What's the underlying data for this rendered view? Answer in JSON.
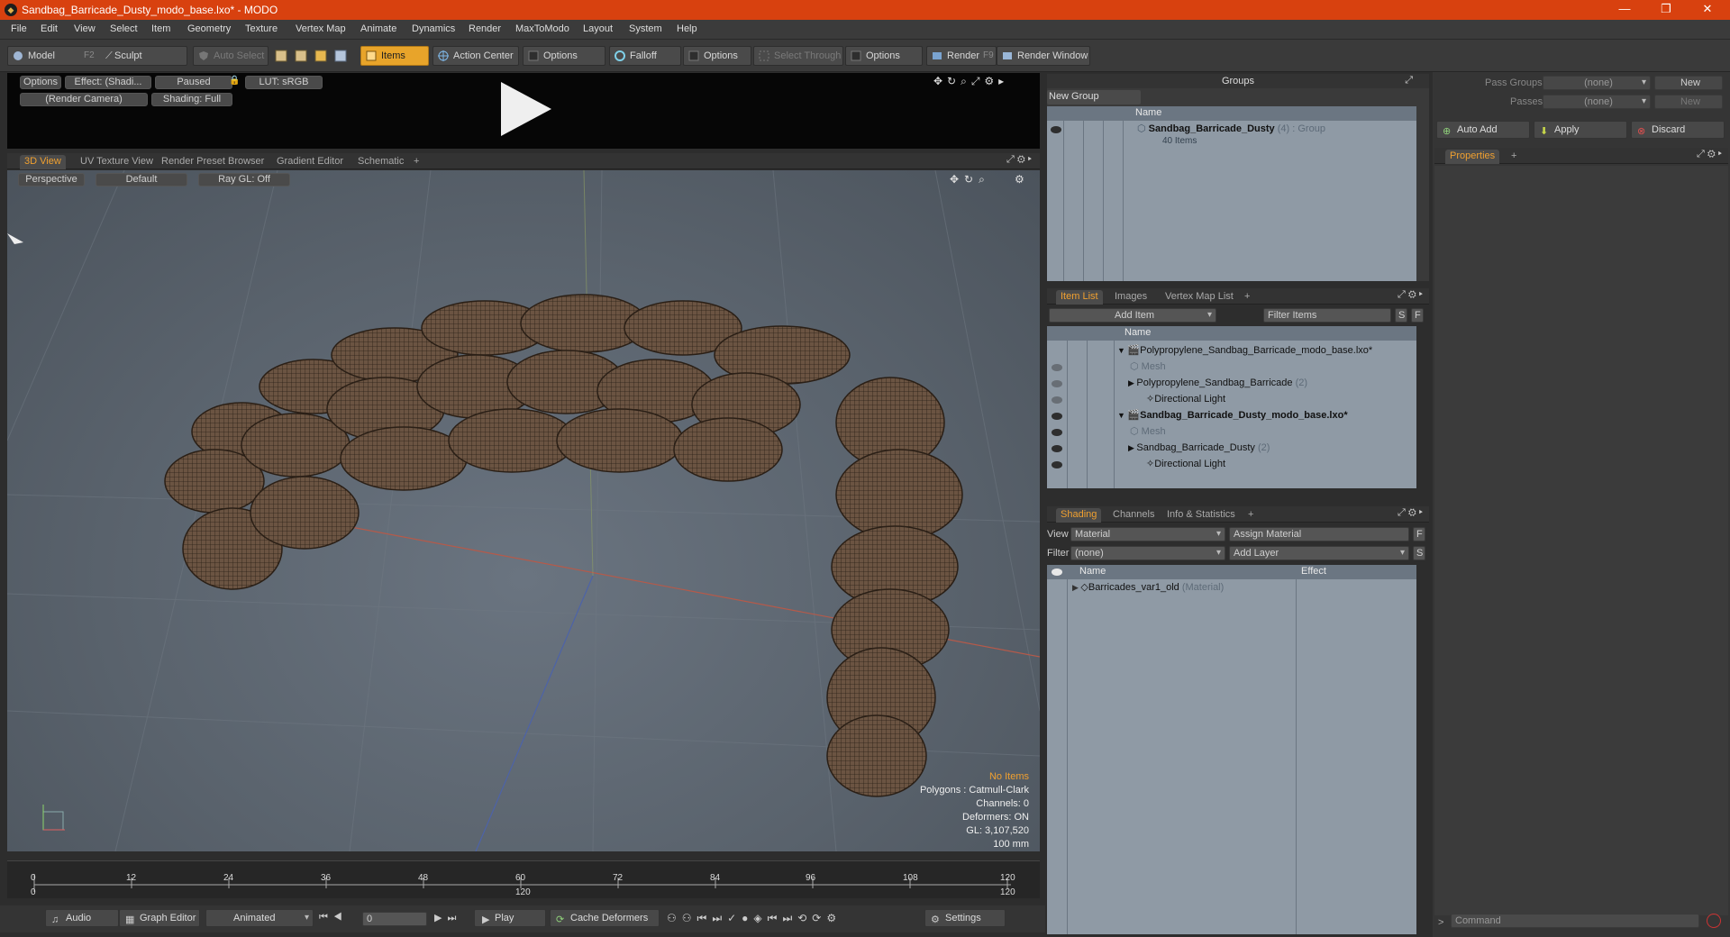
{
  "window": {
    "title": "Sandbag_Barricade_Dusty_modo_base.lxo* - MODO",
    "minimize": "—",
    "maximize": "❐",
    "close": "✕"
  },
  "menu": [
    "File",
    "Edit",
    "View",
    "Select",
    "Item",
    "Geometry",
    "Texture",
    "Vertex Map",
    "Animate",
    "Dynamics",
    "Render",
    "MaxToModo",
    "Layout",
    "System",
    "Help"
  ],
  "toolbar": {
    "model": "Model",
    "model_key": "F2",
    "sculpt": "Sculpt",
    "auto_select": "Auto Select",
    "items": "Items",
    "action_center": "Action Center",
    "options1": "Options",
    "falloff": "Falloff",
    "options2": "Options",
    "select_through": "Select Through",
    "options3": "Options",
    "render": "Render",
    "render_key": "F9",
    "render_window": "Render Window"
  },
  "preview": {
    "options": "Options",
    "effect": "Effect: (Shadi...",
    "paused": "Paused",
    "lut": "LUT: sRGB",
    "camera": "(Render Camera)",
    "shading": "Shading: Full"
  },
  "viewport_tabs": [
    "3D View",
    "UV Texture View",
    "Render Preset Browser",
    "Gradient Editor",
    "Schematic",
    "+"
  ],
  "viewport": {
    "perspective": "Perspective",
    "default": "Default",
    "raygl": "Ray GL: Off",
    "stats": {
      "no_items": "No Items",
      "polygons": "Polygons : Catmull-Clark",
      "channels": "Channels: 0",
      "deformers": "Deformers: ON",
      "gl": "GL: 3,107,520",
      "scale": "100 mm"
    }
  },
  "timeline": {
    "ticks": [
      "0",
      "12",
      "24",
      "36",
      "48",
      "60",
      "72",
      "84",
      "96",
      "108",
      "120"
    ],
    "ticks_bottom": [
      "0",
      "120",
      "120"
    ]
  },
  "bottombar": {
    "audio": "Audio",
    "graph_editor": "Graph Editor",
    "animated": "Animated",
    "frame": "0",
    "play": "Play",
    "cache": "Cache Deformers",
    "settings": "Settings"
  },
  "groups": {
    "title": "Groups",
    "new_group": "New Group",
    "col_name": "Name",
    "item_name": "Sandbag_Barricade_Dusty",
    "item_count": "(4)",
    "item_type": ": Group",
    "item_sub": "40 Items"
  },
  "itemlist": {
    "tabs": [
      "Item List",
      "Images",
      "Vertex Map List",
      "+"
    ],
    "add_item": "Add Item",
    "filter": "Filter Items",
    "s": "S",
    "f": "F",
    "col_name": "Name",
    "rows": [
      {
        "label": "Polypropylene_Sandbag_Barricade_modo_base.lxo*",
        "suffix": ""
      },
      {
        "label": "Mesh",
        "suffix": ""
      },
      {
        "label": "Polypropylene_Sandbag_Barricade",
        "suffix": "(2)"
      },
      {
        "label": "Directional Light",
        "suffix": ""
      },
      {
        "label": "Sandbag_Barricade_Dusty_modo_base.lxo*",
        "suffix": ""
      },
      {
        "label": "Mesh",
        "suffix": ""
      },
      {
        "label": "Sandbag_Barricade_Dusty",
        "suffix": "(2)"
      },
      {
        "label": "Directional Light",
        "suffix": ""
      }
    ]
  },
  "shading": {
    "tabs": [
      "Shading",
      "Channels",
      "Info & Statistics",
      "+"
    ],
    "view_label": "View",
    "view_value": "Material",
    "assign": "Assign Material",
    "filter_label": "Filter",
    "filter_value": "(none)",
    "add_layer": "Add Layer",
    "f": "F",
    "s": "S",
    "col_name": "Name",
    "col_effect": "Effect",
    "item": "Barricades_var1_old",
    "item_type": "(Material)"
  },
  "right": {
    "pass_groups": "Pass Groups",
    "pass_groups_value": "(none)",
    "new": "New",
    "passes": "Passes",
    "passes_value": "(none)",
    "new2": "New",
    "auto_add": "Auto Add",
    "apply": "Apply",
    "discard": "Discard",
    "properties": "Properties",
    "plus": "+",
    "command": "Command"
  },
  "colors": {
    "title_bar": "#d8410f",
    "active": "#e8a42a",
    "sandbag": "#6b5442",
    "viewport_bg": "#5d6670"
  }
}
